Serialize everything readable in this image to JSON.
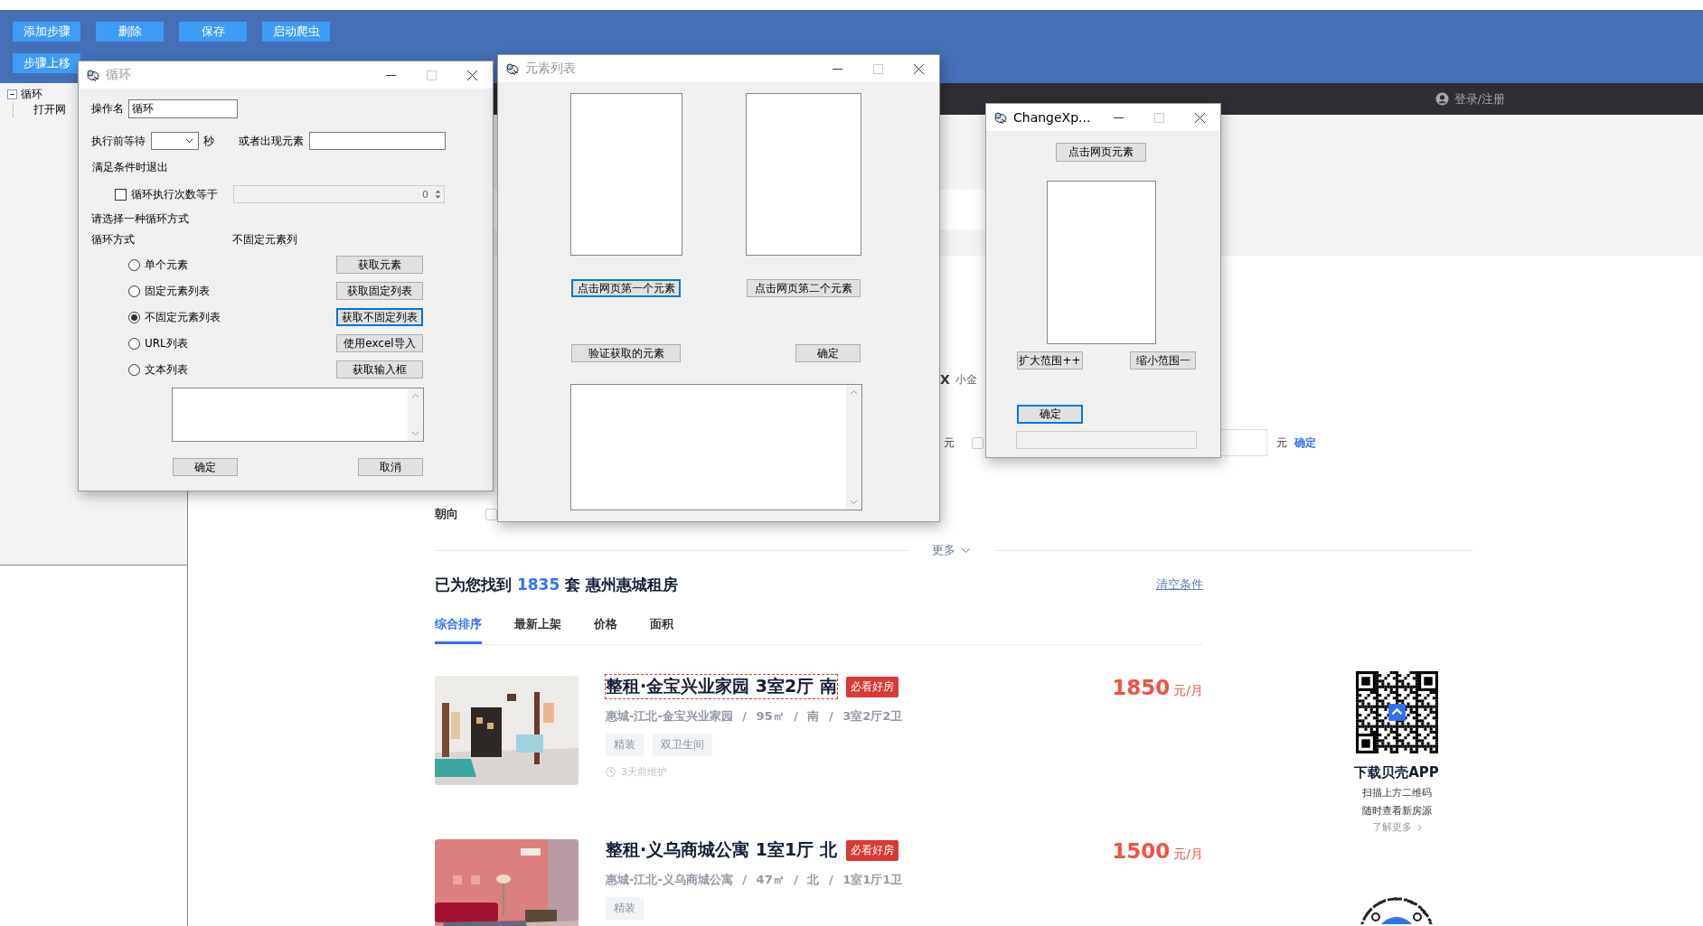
{
  "toolbar": [
    {
      "label": "添加步骤"
    },
    {
      "label": "删除"
    },
    {
      "label": "保存"
    },
    {
      "label": "启动爬虫"
    },
    {
      "label": "步骤上移"
    }
  ],
  "tree": [
    {
      "label": "循环",
      "expanded": true,
      "children": [
        {
          "label": "打开网"
        }
      ]
    }
  ],
  "web": {
    "login": "登录/注册",
    "filter_fragment": {
      "mark": "X",
      "label": "小金"
    },
    "price_filter": {
      "unit_left": "元",
      "checked": false,
      "unit_right": "元",
      "confirm": "确定"
    },
    "orientation": {
      "label": "朝向",
      "checked": false
    },
    "more": "更多",
    "results": {
      "prefix": "已为您找到",
      "count": "1835",
      "suffix": "套 惠州惠城租房"
    },
    "clear": "清空条件",
    "sort_tabs": [
      {
        "label": "综合排序",
        "selected": true
      },
      {
        "label": "最新上架",
        "selected": false
      },
      {
        "label": "价格",
        "selected": false
      },
      {
        "label": "面积",
        "selected": false
      }
    ],
    "listings": [
      {
        "picture": {
          "kind": "picture"
        },
        "title": "整租·金宝兴业家园 3室2厅 南",
        "highlighted": true,
        "badge": "必看好房",
        "price": "1850",
        "price_unit": "元/月",
        "meta": "惠城-江北-金宝兴业家园 / 95㎡ / 南 / 3室2厅2卫",
        "tags": [
          "精装",
          "双卫生间"
        ],
        "updated": "3天前维护"
      },
      {
        "picture": {
          "kind": "picture"
        },
        "title": "整租·义乌商城公寓 1室1厅 北",
        "highlighted": false,
        "badge": "必看好房",
        "price": "1500",
        "price_unit": "元/月",
        "meta": "惠城-江北-义乌商城公寓 / 47㎡ / 北 / 1室1厅1卫",
        "tags": [
          "精装"
        ]
      }
    ],
    "app_promo": {
      "title": "下载贝壳APP",
      "lines": [
        "扫描上方二维码",
        "随时查看新房源"
      ],
      "link": "了解更多"
    }
  },
  "dialogs": [
    {
      "kind": "loop",
      "title": "循环",
      "active": false,
      "name_label": "操作名",
      "name_value": "循环",
      "wait_label": "执行前等待",
      "wait_unit": "秒",
      "appear_label": "或者出现元素",
      "exit_label": "满足条件时退出",
      "count_check": {
        "label": "循环执行次数等于",
        "checked": false
      },
      "count_value": "0",
      "choose_label": "请选择一种循环方式",
      "mode_label": "循环方式",
      "mode_value": "不固定元素列",
      "options": [
        {
          "label": "单个元素",
          "selected": false,
          "button": {
            "label": "获取元素",
            "focused": false
          }
        },
        {
          "label": "固定元素列表",
          "selected": false,
          "button": {
            "label": "获取固定列表",
            "focused": false
          }
        },
        {
          "label": "不固定元素列表",
          "selected": true,
          "button": {
            "label": "获取不固定列表",
            "focused": true
          }
        },
        {
          "label": "URL列表",
          "selected": false,
          "button": {
            "label": "使用excel导入",
            "focused": false
          }
        },
        {
          "label": "文本列表",
          "selected": false,
          "button": {
            "label": "获取输入框",
            "focused": false
          }
        }
      ],
      "ok": {
        "label": "确定",
        "focused": false
      },
      "cancel": {
        "label": "取消",
        "focused": false
      }
    },
    {
      "kind": "element_list",
      "title": "元素列表",
      "active": false,
      "pick_buttons": [
        {
          "label": "点击网页第一个元素",
          "focused": true
        },
        {
          "label": "点击网页第二个元素",
          "focused": false
        }
      ],
      "verify": {
        "label": "验证获取的元素",
        "focused": false
      },
      "ok": {
        "label": "确定",
        "focused": false
      }
    },
    {
      "kind": "xpath",
      "title": "ChangeXp...",
      "active": true,
      "pick": {
        "label": "点击网页元素",
        "focused": false
      },
      "expand": {
        "label": "扩大范围++",
        "focused": false
      },
      "shrink": {
        "label": "缩小范围一",
        "focused": false
      },
      "ok": {
        "label": "确定",
        "focused": true
      }
    }
  ]
}
